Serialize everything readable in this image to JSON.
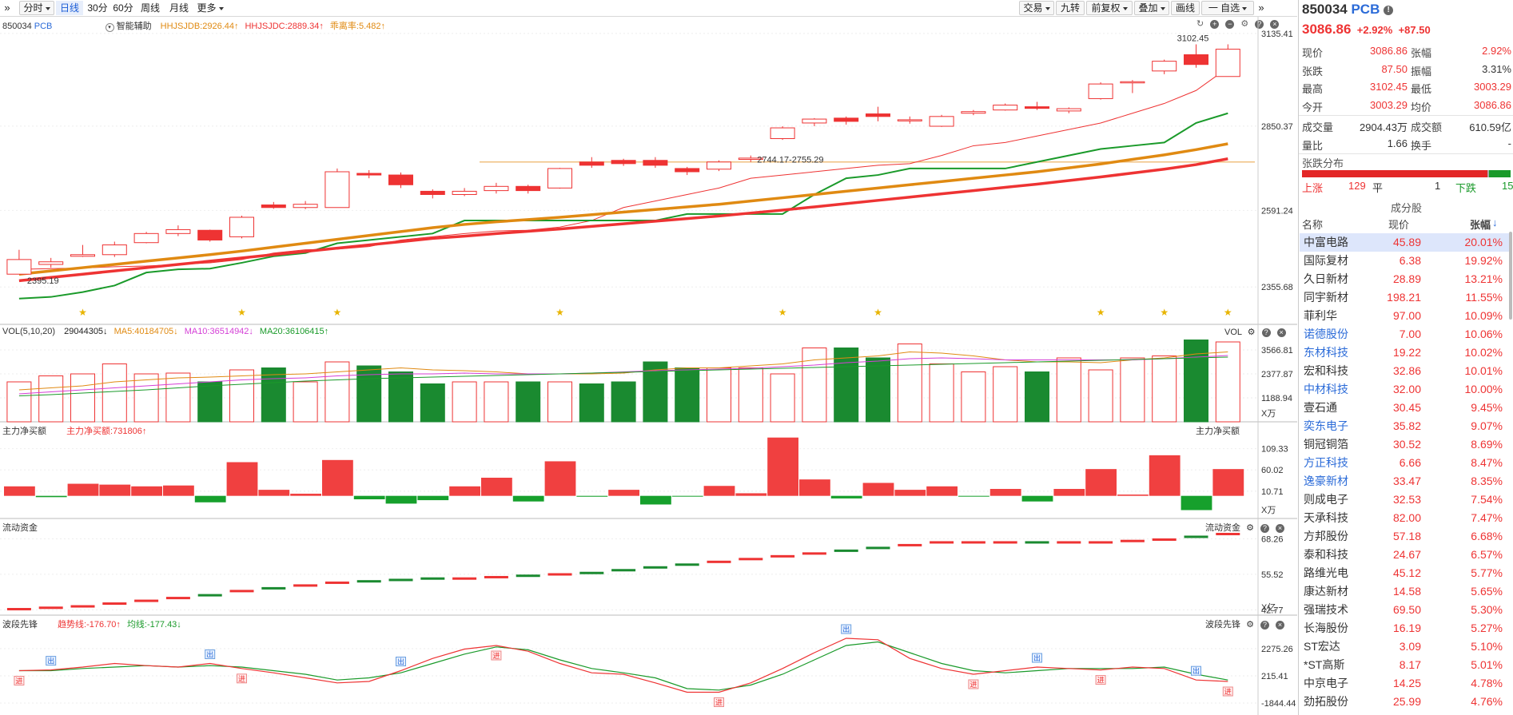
{
  "toolbar": {
    "left_tabs": [
      "分时",
      "日线",
      "30分",
      "60分",
      "周线",
      "月线",
      "更多"
    ],
    "selected_tab": "日线",
    "right_buttons": [
      "交易",
      "九转",
      "前复权",
      "叠加",
      "画线",
      "一 自选"
    ]
  },
  "main_panel": {
    "code": "850034",
    "name": "PCB",
    "assist_label": "智能辅助",
    "indicators": [
      {
        "text": "HHJSJDB:2926.44",
        "color": "#e08a12",
        "dir": "up"
      },
      {
        "text": "HHJSJDC:2889.34",
        "color": "#e33",
        "dir": "up"
      },
      {
        "text": "乖离率:5.482",
        "color": "#e08a12",
        "dir": "up"
      }
    ],
    "y_ticks": [
      "3135.41",
      "2850.37",
      "2591.24",
      "2355.68"
    ],
    "annotations": {
      "high": "3102.45",
      "low": "2395.19",
      "mid": "2744.17-2755.29"
    }
  },
  "vol_panel": {
    "label": "VOL(5,10,20)",
    "values": [
      {
        "text": "29044305",
        "color": "#222",
        "dir": "down"
      },
      {
        "text": "MA5:40184705",
        "color": "#e08a12",
        "dir": "down"
      },
      {
        "text": "MA10:36514942",
        "color": "#d43fd6",
        "dir": "down"
      },
      {
        "text": "MA20:36106415",
        "color": "#1a9a2a",
        "dir": "up"
      }
    ],
    "right_label": "VOL",
    "y_ticks": [
      "3566.81",
      "2377.87",
      "1188.94"
    ],
    "unit": "X万"
  },
  "flow_panel": {
    "label": "主力净买额",
    "value": {
      "text": "主力净买额:731806",
      "color": "#e33",
      "dir": "up"
    },
    "right_label": "主力净买额",
    "y_ticks": [
      "109.33",
      "60.02",
      "10.71"
    ],
    "unit": "X万"
  },
  "liquid_panel": {
    "label": "流动资金",
    "right_label": "流动资金",
    "y_ticks": [
      "68.26",
      "55.52",
      "42.77"
    ],
    "unit": "X亿"
  },
  "wave_panel": {
    "label": "波段先锋",
    "values": [
      {
        "text": "趋势线:-176.70",
        "color": "#e33",
        "dir": "up"
      },
      {
        "text": "均线:-177.43",
        "color": "#1a9a2a",
        "dir": "down"
      }
    ],
    "right_label": "波段先锋",
    "y_ticks": [
      "2275.26",
      "215.41",
      "-1844.44"
    ],
    "sell_mark": "出",
    "buy_mark": "进"
  },
  "chart_data": {
    "type": "candlestick",
    "candles": [
      [
        2395,
        2440,
        2470,
        2395
      ],
      [
        2425,
        2433,
        2445,
        2415
      ],
      [
        2450,
        2455,
        2485,
        2448
      ],
      [
        2455,
        2485,
        2495,
        2448
      ],
      [
        2492,
        2520,
        2525,
        2490
      ],
      [
        2520,
        2532,
        2545,
        2512
      ],
      [
        2530,
        2500,
        2532,
        2495
      ],
      [
        2510,
        2570,
        2575,
        2505
      ],
      [
        2608,
        2600,
        2617,
        2596
      ],
      [
        2600,
        2610,
        2620,
        2595
      ],
      [
        2600,
        2710,
        2720,
        2600
      ],
      [
        2705,
        2700,
        2715,
        2690
      ],
      [
        2700,
        2670,
        2708,
        2660
      ],
      [
        2650,
        2640,
        2656,
        2628
      ],
      [
        2640,
        2650,
        2660,
        2635
      ],
      [
        2652,
        2665,
        2676,
        2643
      ],
      [
        2665,
        2652,
        2670,
        2643
      ],
      [
        2660,
        2720,
        2722,
        2658
      ],
      [
        2740,
        2730,
        2755,
        2722
      ],
      [
        2745,
        2735,
        2750,
        2728
      ],
      [
        2745,
        2730,
        2755,
        2722
      ],
      [
        2720,
        2710,
        2725,
        2700
      ],
      [
        2718,
        2740,
        2745,
        2712
      ],
      [
        2748,
        2752,
        2760,
        2740
      ],
      [
        2812,
        2845,
        2850,
        2808
      ],
      [
        2860,
        2872,
        2875,
        2850
      ],
      [
        2875,
        2865,
        2880,
        2855
      ],
      [
        2888,
        2880,
        2910,
        2865
      ],
      [
        2870,
        2870,
        2880,
        2858
      ],
      [
        2850,
        2880,
        2885,
        2848
      ],
      [
        2890,
        2895,
        2900,
        2884
      ],
      [
        2900,
        2915,
        2920,
        2898
      ],
      [
        2910,
        2905,
        2925,
        2900
      ],
      [
        2897,
        2904,
        2908,
        2890
      ],
      [
        2935,
        2980,
        2985,
        2932
      ],
      [
        2985,
        2987,
        2992,
        2952
      ],
      [
        3020,
        3050,
        3055,
        3010
      ],
      [
        3070,
        3040,
        3102,
        3030
      ],
      [
        3003,
        3087,
        3102,
        3003
      ]
    ],
    "upper_line": [
      2410,
      2412,
      2414,
      2418,
      2420,
      2425,
      2430,
      2440,
      2460,
      2470,
      2472,
      2480,
      2500,
      2510,
      2520,
      2528,
      2530,
      2540,
      2560,
      2600,
      2620,
      2640,
      2660,
      2690,
      2700,
      2710,
      2720,
      2730,
      2735,
      2760,
      2790,
      2800,
      2820,
      2840,
      2860,
      2890,
      2920,
      2960,
      3030
    ],
    "lower_line": [
      2320,
      2325,
      2340,
      2360,
      2400,
      2410,
      2412,
      2430,
      2450,
      2460,
      2490,
      2500,
      2510,
      2520,
      2560,
      2560,
      2560,
      2560,
      2560,
      2560,
      2560,
      2580,
      2580,
      2580,
      2580,
      2640,
      2690,
      2700,
      2720,
      2720,
      2720,
      2720,
      2740,
      2760,
      2780,
      2790,
      2800,
      2860,
      2890
    ],
    "ma_slow_red": [
      2375,
      2385,
      2395,
      2405,
      2415,
      2425,
      2435,
      2445,
      2455,
      2465,
      2475,
      2485,
      2495,
      2505,
      2512,
      2520,
      2527,
      2534,
      2542,
      2550,
      2558,
      2566,
      2574,
      2583,
      2592,
      2602,
      2612,
      2622,
      2632,
      2642,
      2652,
      2662,
      2672,
      2683,
      2694,
      2706,
      2718,
      2732,
      2750
    ],
    "ma_fast_orange": [
      2395,
      2405,
      2415,
      2425,
      2435,
      2445,
      2455,
      2466,
      2478,
      2490,
      2502,
      2514,
      2526,
      2538,
      2548,
      2556,
      2563,
      2570,
      2578,
      2586,
      2594,
      2602,
      2610,
      2620,
      2630,
      2640,
      2650,
      2660,
      2670,
      2680,
      2690,
      2700,
      2710,
      2722,
      2734,
      2748,
      2762,
      2778,
      2796
    ],
    "ma_green": [
      2305,
      2312,
      2320,
      2340,
      2360,
      2372,
      2380,
      2395,
      2405,
      2416,
      2465,
      2480,
      2480,
      2480,
      2480,
      2480,
      2480,
      2480,
      2480,
      2480,
      2480,
      2480,
      2480,
      2480,
      2550,
      2600,
      2600,
      2600,
      2600,
      2600,
      2600,
      2610,
      2620,
      2620,
      2670,
      2670,
      2700,
      2700,
      2710
    ],
    "stars": [
      2,
      7,
      10,
      17,
      24,
      27,
      34,
      36,
      38
    ],
    "volumes": [
      1.0,
      1.15,
      1.2,
      1.45,
      1.2,
      1.22,
      1.0,
      1.3,
      1.35,
      1.0,
      1.5,
      1.4,
      1.25,
      0.95,
      1.0,
      1.0,
      1.0,
      1.0,
      0.95,
      1.0,
      1.5,
      1.35,
      1.35,
      1.35,
      1.2,
      1.85,
      1.85,
      1.6,
      1.95,
      1.45,
      1.25,
      1.38,
      1.25,
      1.6,
      1.3,
      1.6,
      1.65,
      2.05,
      2.0,
      1.3
    ],
    "vol_ma5": [
      0.8,
      0.85,
      0.9,
      1.0,
      1.05,
      1.1,
      1.12,
      1.15,
      1.18,
      1.2,
      1.25,
      1.3,
      1.35,
      1.3,
      1.28,
      1.25,
      1.2,
      1.2,
      1.2,
      1.22,
      1.3,
      1.35,
      1.35,
      1.4,
      1.45,
      1.55,
      1.6,
      1.65,
      1.75,
      1.72,
      1.65,
      1.55,
      1.5,
      1.5,
      1.48,
      1.55,
      1.6,
      1.7,
      1.75,
      1.7
    ],
    "vol_ma10": [
      0.7,
      0.75,
      0.8,
      0.85,
      0.9,
      0.95,
      1.0,
      1.05,
      1.08,
      1.1,
      1.15,
      1.18,
      1.2,
      1.2,
      1.22,
      1.2,
      1.2,
      1.2,
      1.22,
      1.25,
      1.28,
      1.3,
      1.32,
      1.34,
      1.38,
      1.42,
      1.48,
      1.52,
      1.58,
      1.6,
      1.58,
      1.55,
      1.55,
      1.55,
      1.55,
      1.55,
      1.58,
      1.62,
      1.66,
      1.7
    ],
    "vol_ma20": [
      0.65,
      0.68,
      0.72,
      0.76,
      0.8,
      0.85,
      0.9,
      0.94,
      0.98,
      1.02,
      1.05,
      1.08,
      1.1,
      1.12,
      1.14,
      1.16,
      1.18,
      1.2,
      1.22,
      1.24,
      1.26,
      1.28,
      1.3,
      1.32,
      1.34,
      1.36,
      1.38,
      1.4,
      1.42,
      1.44,
      1.46,
      1.48,
      1.5,
      1.52,
      1.54,
      1.56,
      1.58,
      1.6,
      1.62,
      1.64
    ],
    "net_flow": [
      22,
      -3,
      28,
      26,
      22,
      24,
      -15,
      78,
      14,
      5,
      83,
      -8,
      -18,
      -10,
      22,
      42,
      -13,
      80,
      -2,
      14,
      -20,
      -1,
      23,
      6,
      135,
      38,
      -6,
      30,
      14,
      22,
      -1,
      16,
      -13,
      16,
      62,
      3,
      94,
      -33,
      62
    ],
    "liquid": [
      43,
      43.5,
      44,
      45,
      46,
      47,
      48,
      49.5,
      50.5,
      51.5,
      52.5,
      53,
      53.5,
      54,
      54,
      54.5,
      55,
      55.5,
      56,
      57,
      58,
      59,
      60,
      61,
      62,
      63,
      64,
      65,
      66,
      67,
      67,
      67,
      67,
      67,
      67,
      67.5,
      68,
      69,
      70
    ]
  }
}
